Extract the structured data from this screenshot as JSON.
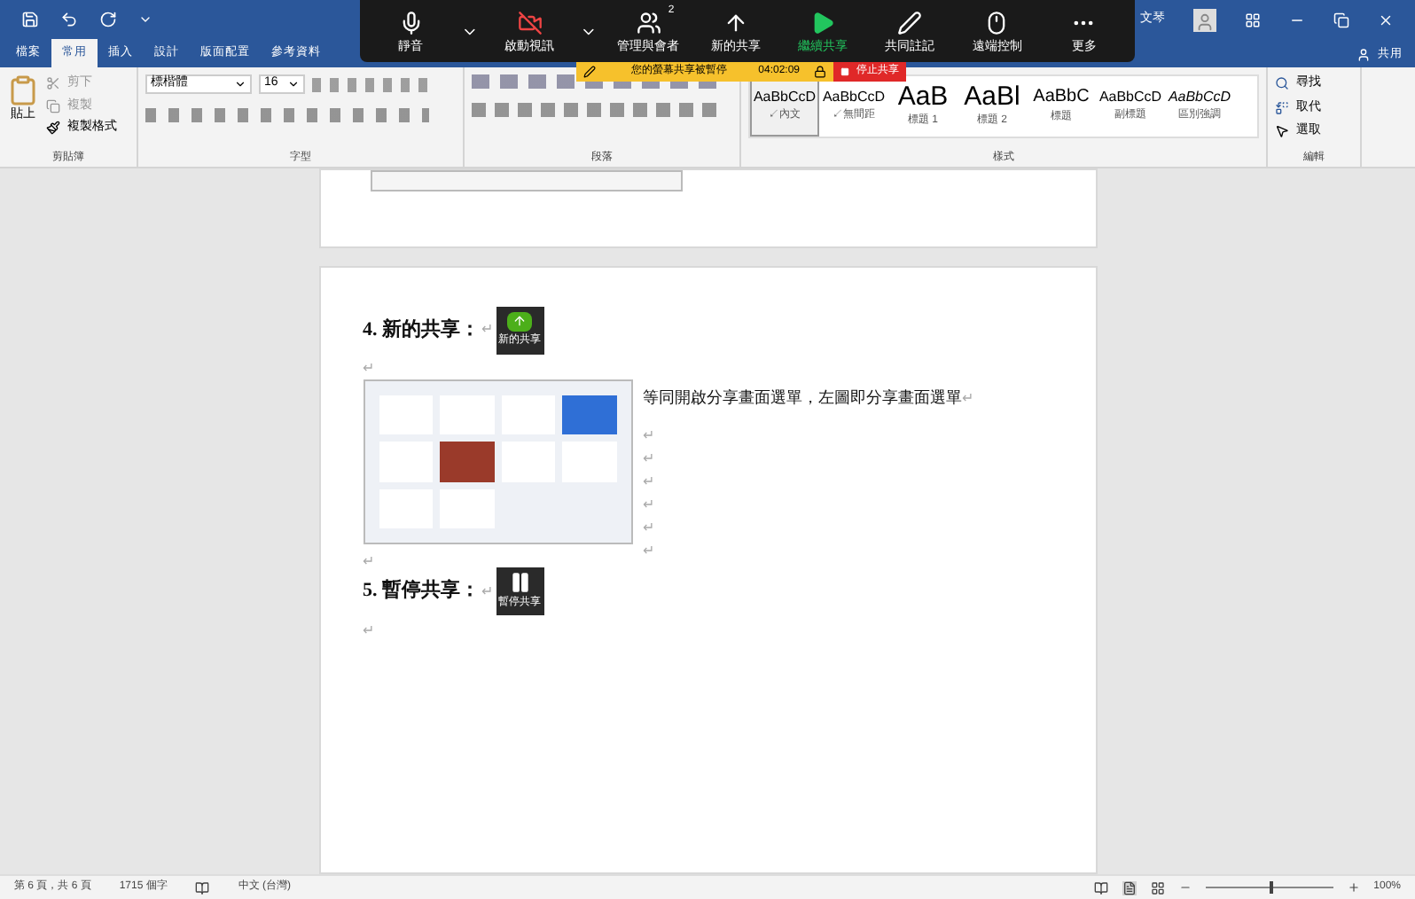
{
  "title_bar": {
    "user": "文琴",
    "share": "共用"
  },
  "ribbon_tabs": [
    {
      "label": "檔案",
      "selected": false
    },
    {
      "label": "常用",
      "selected": true
    },
    {
      "label": "插入",
      "selected": false
    },
    {
      "label": "設計",
      "selected": false
    },
    {
      "label": "版面配置",
      "selected": false
    },
    {
      "label": "參考資料",
      "selected": false
    }
  ],
  "meeting_toolbar": {
    "participants_count": "2",
    "buttons": [
      {
        "kind": "mic",
        "label": "靜音",
        "has_menu": true,
        "highlighted": false
      },
      {
        "kind": "video",
        "label": "啟動視訊",
        "has_menu": true,
        "highlighted": false
      },
      {
        "kind": "participants",
        "label": "管理與會者",
        "has_menu": false,
        "highlighted": false
      },
      {
        "kind": "share",
        "label": "新的共享",
        "has_menu": false,
        "highlighted": false
      },
      {
        "kind": "resume",
        "label": "繼續共享",
        "has_menu": false,
        "highlighted": true
      },
      {
        "kind": "annotate",
        "label": "共同註記",
        "has_menu": false,
        "highlighted": false
      },
      {
        "kind": "remote",
        "label": "遠端控制",
        "has_menu": false,
        "highlighted": false
      },
      {
        "kind": "more",
        "label": "更多",
        "has_menu": false,
        "highlighted": false
      }
    ]
  },
  "pause_banner": {
    "message": "您的螢幕共享被暫停",
    "timer": "04:02:09",
    "stop": "停止共享"
  },
  "ribbon": {
    "clipboard": {
      "paste": "貼上",
      "cut": "剪下",
      "copy": "複製",
      "format_painter": "複製格式",
      "group": "剪貼簿"
    },
    "font": {
      "name": "標楷體",
      "size": "16",
      "group": "字型"
    },
    "paragraph": {
      "group": "段落"
    },
    "styles": {
      "group": "樣式",
      "items": [
        {
          "kind": "body",
          "preview": "AaBbCcD",
          "label": "↙內文",
          "selected": true
        },
        {
          "kind": "body",
          "preview": "AaBbCcD",
          "label": "↙無間距",
          "selected": false
        },
        {
          "kind": "heading",
          "preview": "AaB",
          "label": "標題 1",
          "selected": false
        },
        {
          "kind": "heading",
          "preview": "AaBl",
          "label": "標題 2",
          "selected": false
        },
        {
          "kind": "title",
          "preview": "AaBbC",
          "label": "標題",
          "selected": false
        },
        {
          "kind": "body",
          "preview": "AaBbCcD",
          "label": "副標題",
          "selected": false
        },
        {
          "kind": "emphasis",
          "preview": "AaBbCcD",
          "label": "區別強調",
          "selected": false
        }
      ]
    },
    "editing": {
      "find": "尋找",
      "replace": "取代",
      "select": "選取",
      "group": "編輯"
    }
  },
  "document": {
    "paragraphs": [
      {
        "kind": "heading",
        "text": "4. 新的共享：",
        "mark": "↵",
        "badge": {
          "kind": "share",
          "label": "新的共享"
        }
      },
      {
        "kind": "empty",
        "mark": "↵"
      },
      {
        "kind": "figure",
        "text": "等同開啟分享畫面選單，左圖即分享畫面選單",
        "mark": "↵",
        "side_marks": [
          "↵",
          "↵",
          "↵",
          "↵",
          "↵",
          "↵"
        ]
      },
      {
        "kind": "empty",
        "mark": "↵"
      },
      {
        "kind": "heading",
        "text": "5. 暫停共享：",
        "mark": "↵",
        "badge": {
          "kind": "pause",
          "label": "暫停共享"
        }
      },
      {
        "kind": "empty",
        "mark": "↵"
      }
    ]
  },
  "status_bar": {
    "page": "第 6 頁，共 6 頁",
    "words": "1715 個字",
    "language": "中文 (台灣)",
    "zoom": "100%",
    "zoom_level": {
      "level": 0.5
    }
  }
}
